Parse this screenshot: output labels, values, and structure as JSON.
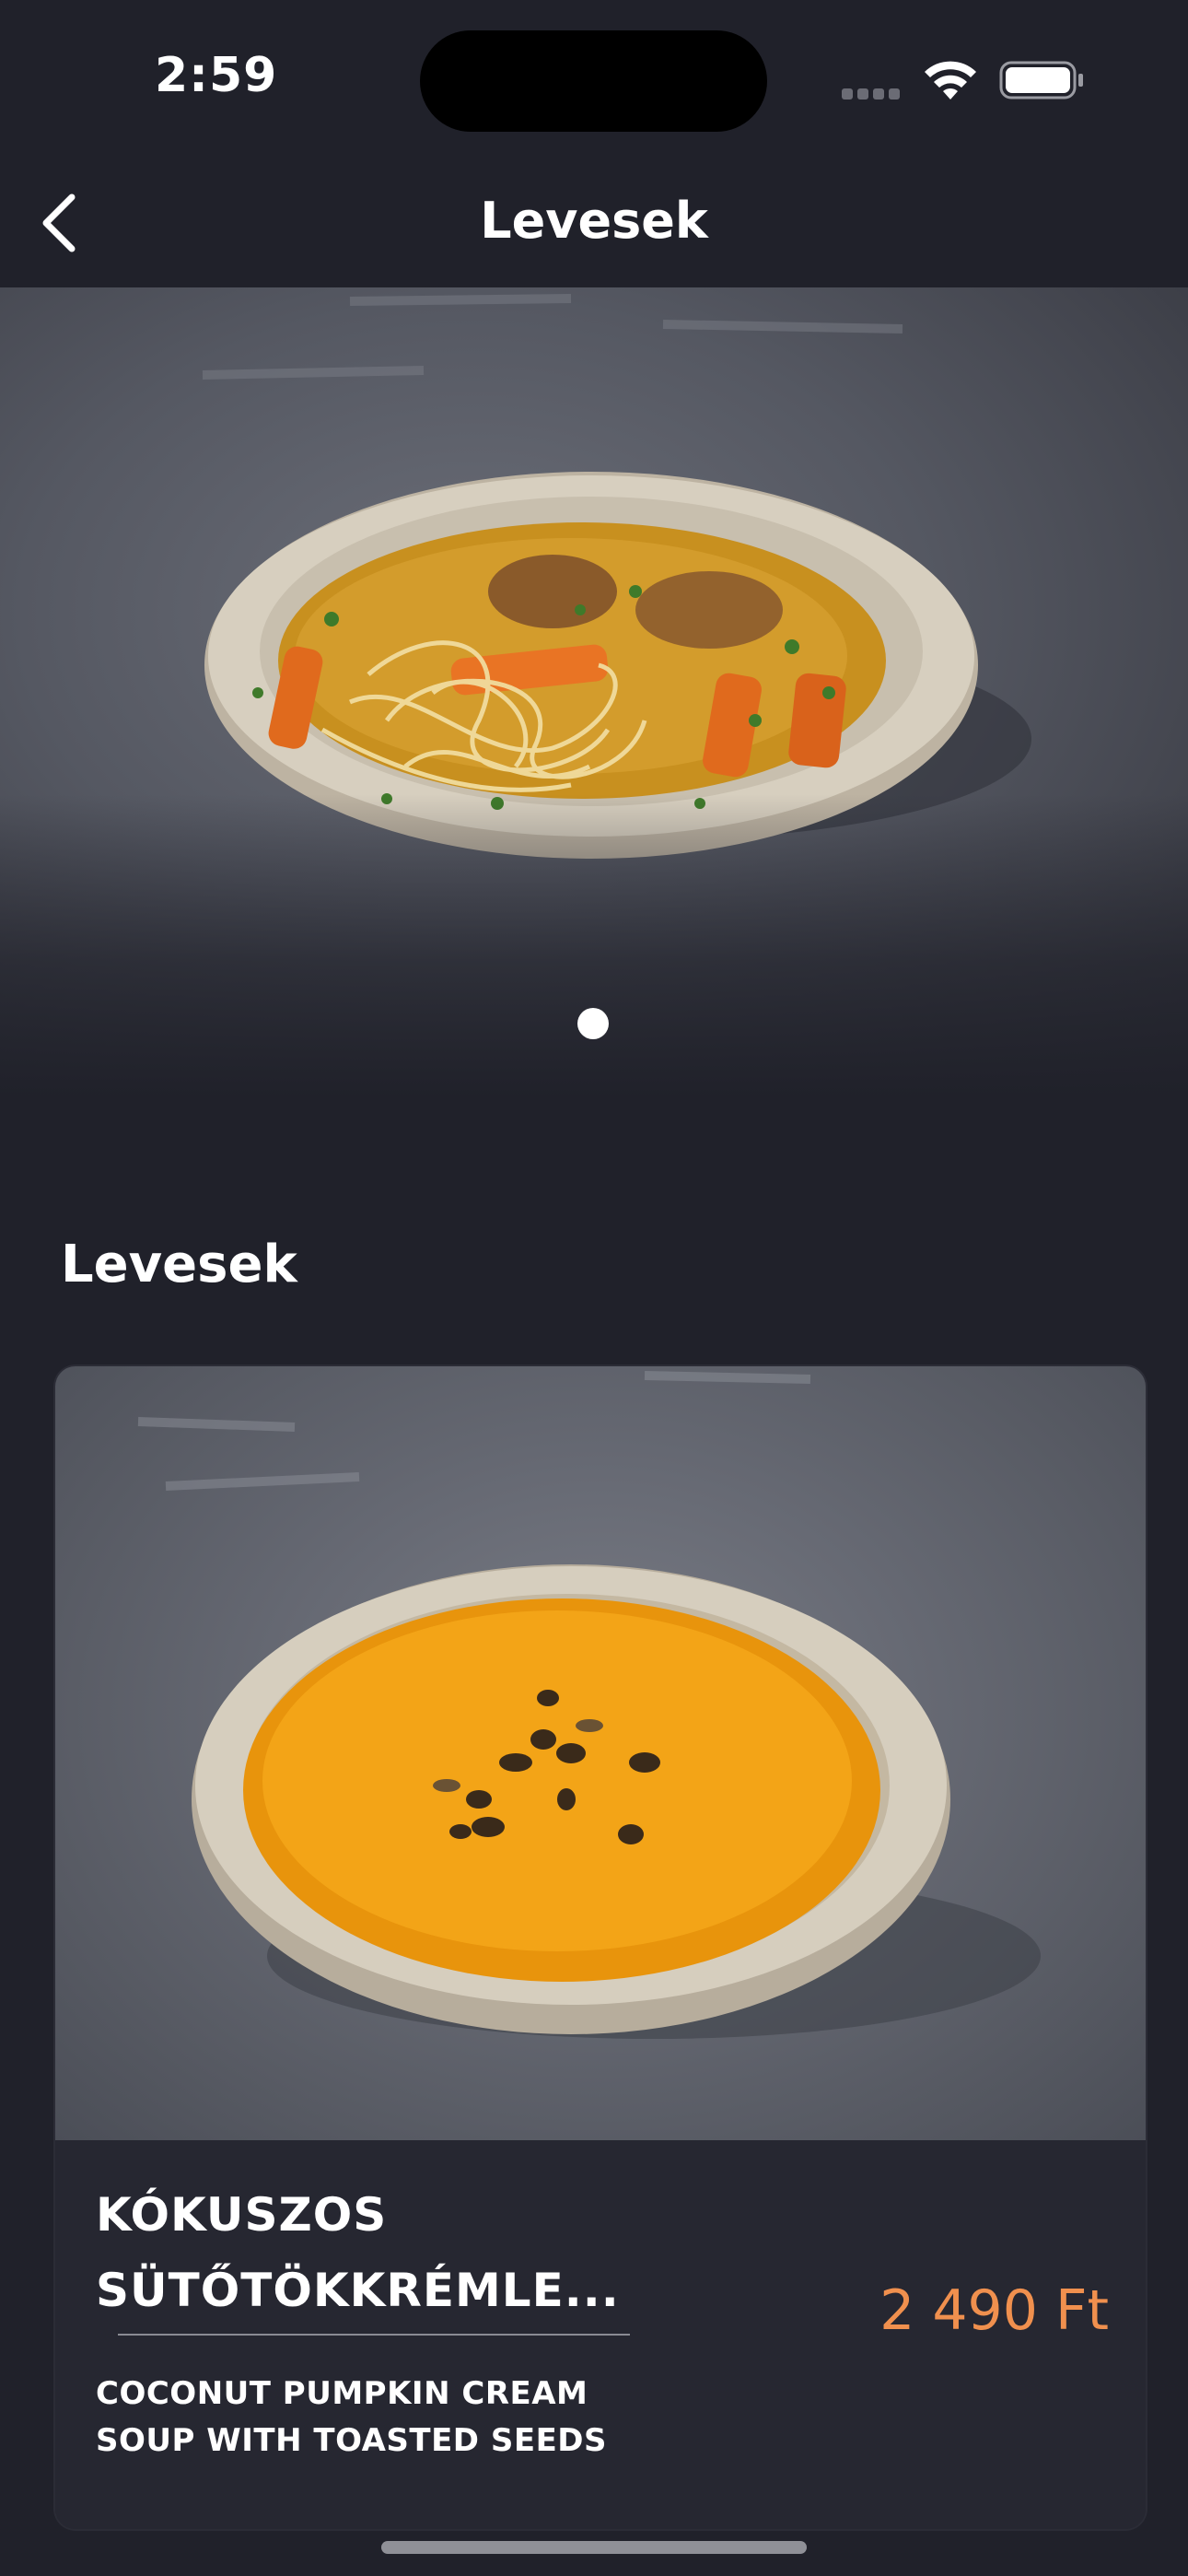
{
  "status_bar": {
    "time": "2:59"
  },
  "header": {
    "title": "Levesek"
  },
  "hero": {
    "page_count": 1,
    "active_page": 1
  },
  "section": {
    "title": "Levesek"
  },
  "product": {
    "name": "KÓKUSZOS SÜTŐTÖKKRÉMLE...",
    "description": "COCONUT PUMPKIN CREAM SOUP WITH TOASTED SEEDS",
    "price": "2 490 Ft"
  },
  "colors": {
    "background": "#20212a",
    "card": "#262731",
    "price_accent": "#f0904e"
  },
  "icons": [
    "back-chevron-icon",
    "signal-icon",
    "wifi-icon",
    "battery-icon"
  ]
}
